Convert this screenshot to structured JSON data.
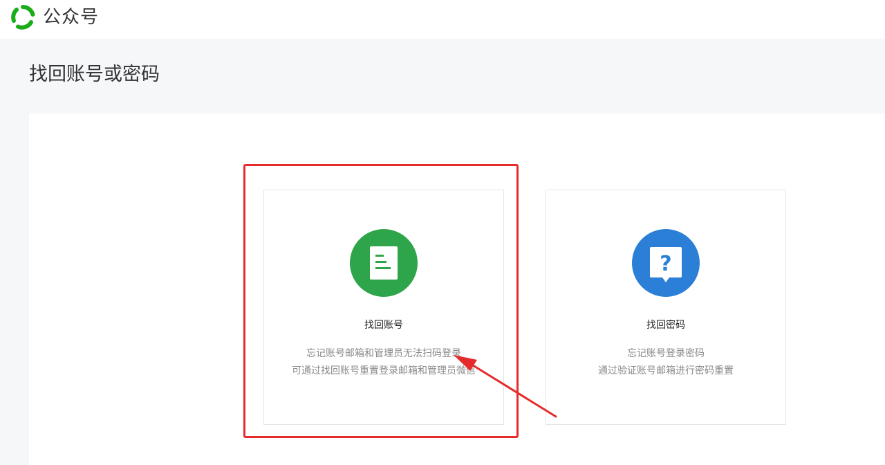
{
  "header": {
    "brand_name": "公众号",
    "logo_color": "#1aad19"
  },
  "page": {
    "title": "找回账号或密码"
  },
  "cards": [
    {
      "title": "找回账号",
      "desc_line_1": "忘记账号邮箱和管理员无法扫码登录",
      "desc_line_2": "可通过找回账号重置登录邮箱和管理员微信",
      "icon": "document-icon",
      "icon_color": "#2ea54a"
    },
    {
      "title": "找回密码",
      "desc_line_1": "忘记账号登录密码",
      "desc_line_2": "通过验证账号邮箱进行密码重置",
      "icon": "question-icon",
      "icon_color": "#2b7fd6"
    }
  ],
  "annotation": {
    "color": "#e52b2b"
  }
}
